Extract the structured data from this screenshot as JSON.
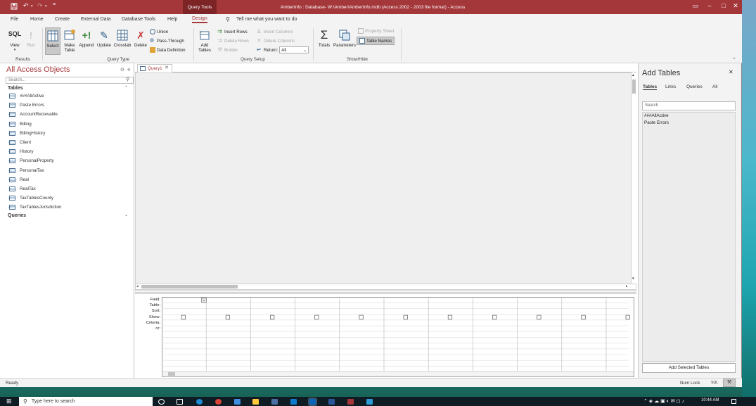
{
  "titlebar": {
    "context_tab": "Query Tools",
    "title": "AmberInfo : Database- W:\\Amber\\AmberInfo.mdb (Access 2002 - 2003 file format)  -  Access"
  },
  "menu": {
    "tabs": [
      "File",
      "Home",
      "Create",
      "External Data",
      "Database Tools",
      "Help",
      "Design"
    ],
    "active": "Design",
    "tell_me": "Tell me what you want to do"
  },
  "ribbon": {
    "results": {
      "label": "Results",
      "sql": "SQL",
      "view": "View",
      "run": "Run"
    },
    "query_type": {
      "label": "Query Type",
      "select": "Select",
      "make_table": "Make Table",
      "append": "Append",
      "update": "Update",
      "crosstab": "Crosstab",
      "delete": "Delete",
      "union": "Union",
      "pass_through": "Pass-Through",
      "data_definition": "Data Definition"
    },
    "query_setup": {
      "label": "Query Setup",
      "add_tables": "Add Tables",
      "insert_rows": "Insert Rows",
      "delete_rows": "Delete Rows",
      "builder": "Builder",
      "insert_columns": "Insert Columns",
      "delete_columns": "Delete Columns",
      "return_label": "Return:",
      "return_value": "All"
    },
    "show_hide": {
      "label": "Show/Hide",
      "totals": "Totals",
      "parameters": "Parameters",
      "property_sheet": "Property Sheet",
      "table_names": "Table Names"
    }
  },
  "nav": {
    "title": "All Access Objects",
    "search_placeholder": "Search...",
    "tables_header": "Tables",
    "queries_header": "Queries",
    "tables": [
      {
        "name": "###AllActive",
        "linked": false
      },
      {
        "name": "Paste Errors",
        "linked": false
      },
      {
        "name": "AccountRecievable",
        "linked": true
      },
      {
        "name": "Billing",
        "linked": true
      },
      {
        "name": "BillingHistory",
        "linked": true
      },
      {
        "name": "Client",
        "linked": true
      },
      {
        "name": "History",
        "linked": true
      },
      {
        "name": "PersonalProperty",
        "linked": true
      },
      {
        "name": "PersonalTax",
        "linked": true
      },
      {
        "name": "Real",
        "linked": true
      },
      {
        "name": "RealTax",
        "linked": true
      },
      {
        "name": "TaxTablesCounty",
        "linked": true
      },
      {
        "name": "TaxTablesJurisdiction",
        "linked": true
      }
    ]
  },
  "document": {
    "tab_label": "Query1",
    "grid_rows": [
      "Field:",
      "Table:",
      "Sort:",
      "Show:",
      "Criteria:",
      "or:"
    ]
  },
  "add_tables": {
    "title": "Add Tables",
    "tabs": [
      "Tables",
      "Links",
      "Queries",
      "All"
    ],
    "active_tab": "Tables",
    "search_placeholder": "Search",
    "items": [
      "###AllActive",
      "Paste Errors"
    ],
    "button": "Add Selected Tables"
  },
  "status": {
    "left": "Ready",
    "num_lock": "Num Lock",
    "sql_icon": "SQL"
  },
  "taskbar": {
    "search_placeholder": "Type here to search",
    "time": "10:44 AM"
  },
  "colors": {
    "accent": "#a4373a",
    "ribbon_bg": "#f3f3f3"
  }
}
